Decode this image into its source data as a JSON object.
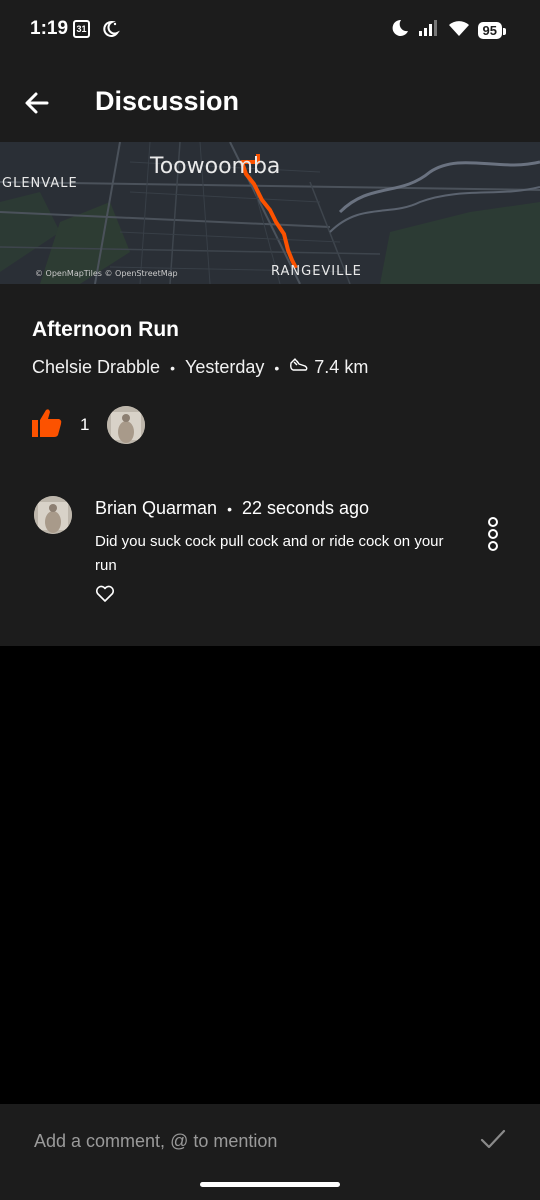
{
  "status": {
    "time": "1:19",
    "calendar_day": "31",
    "battery": "95",
    "icons": [
      "calendar-icon",
      "bedtime-icon",
      "dnd-moon-icon",
      "signal-icon",
      "wifi-icon",
      "battery-icon"
    ]
  },
  "appbar": {
    "title": "Discussion",
    "back_icon": "back-arrow-icon"
  },
  "map": {
    "labels": {
      "city": "Toowoomba",
      "west": "GLENVALE",
      "south": "RANGEVILLE"
    },
    "attribution": "© OpenMapTiles © OpenStreetMap",
    "route_color": "#fc5200"
  },
  "activity": {
    "title": "Afternoon Run",
    "athlete": "Chelsie Drabble",
    "when": "Yesterday",
    "distance": "7.4 km",
    "kudos_count": "1",
    "kudos_color": "#fc5200"
  },
  "comment": {
    "author": "Brian Quarman",
    "time": "22 seconds ago",
    "text": "Did you suck cock pull cock and or ride cock on your run"
  },
  "composer": {
    "placeholder": "Add a comment, @ to mention"
  },
  "colors": {
    "surface": "#1c1c1c",
    "background": "#000000",
    "accent": "#fc5200"
  }
}
